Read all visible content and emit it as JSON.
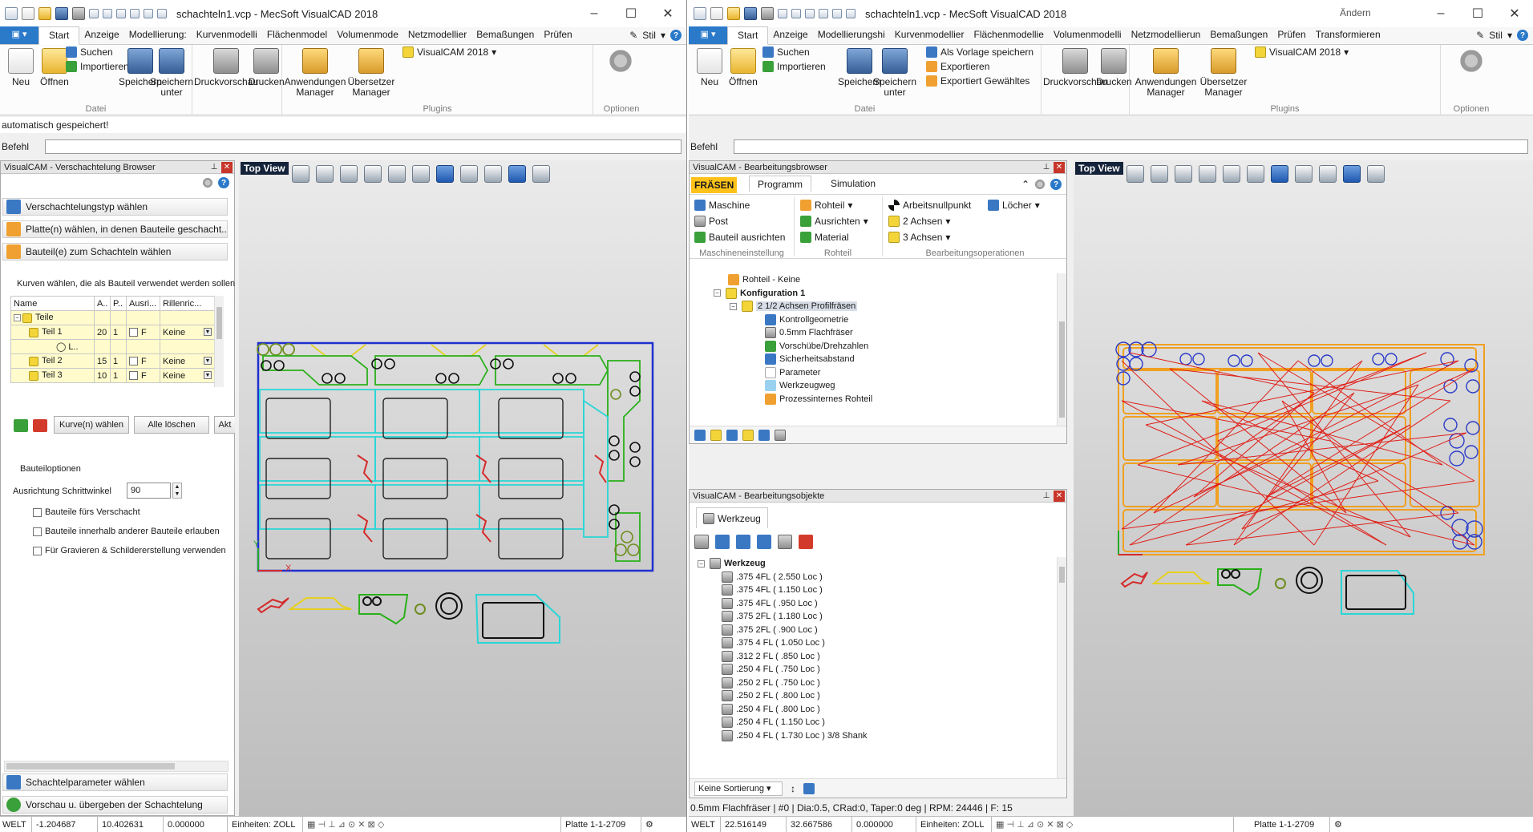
{
  "left": {
    "title": "schachteln1.vcp - MecSoft VisualCAD 2018",
    "tabs": [
      "Start",
      "Anzeige",
      "Modellierung:",
      "Kurvenmodelli",
      "Flächenmodel",
      "Volumenmode",
      "Netzmodellier",
      "Bemaßungen",
      "Prüfen"
    ],
    "style_label": "Stil",
    "ribbon": {
      "new": "Neu",
      "open": "Öffnen",
      "search": "Suchen",
      "import": "Importieren",
      "save": "Speichern",
      "save_as": "Speichern unter",
      "group_file": "Datei",
      "preview": "Druckvorschau",
      "print": "Drucken",
      "app_manager": "Anwendungen Manager",
      "translator": "Übersetzer Manager",
      "visualcam": "VisualCAM 2018",
      "group_plugins": "Plugins",
      "options_group": "Optionen"
    },
    "status_msg": "automatisch gespeichert!",
    "command_label": "Befehl",
    "nest_panel": {
      "title": "VisualCAM - Verschachtelung Browser",
      "step1": "Verschachtelungstyp wählen",
      "step2": "Platte(n) wählen, in denen Bauteile geschacht...",
      "step3": "Bauteil(e) zum Schachteln wählen",
      "hint": "Kurven wählen, die als Bauteil verwendet werden sollen",
      "cols": [
        "Name",
        "A..",
        "P..",
        "Ausri...",
        "Rillenric..."
      ],
      "rows": [
        {
          "name": "Teile",
          "a": "",
          "p": "",
          "aus": "",
          "ril": ""
        },
        {
          "name": "Teil 1",
          "a": "20",
          "p": "1",
          "aus": "F",
          "ril": "Keine"
        },
        {
          "name": "L..",
          "a": "",
          "p": "",
          "aus": "",
          "ril": ""
        },
        {
          "name": "Teil 2",
          "a": "15",
          "p": "1",
          "aus": "F",
          "ril": "Keine"
        },
        {
          "name": "Teil 3",
          "a": "10",
          "p": "1",
          "aus": "F",
          "ril": "Keine"
        }
      ],
      "btn_curves": "Kurve(n) wählen",
      "btn_clear": "Alle löschen",
      "btn_more": "Akt",
      "options_title": "Bauteiloptionen",
      "angle_label": "Ausrichtung Schrittwinkel",
      "angle_value": "90",
      "opt1": "Bauteile fürs Verschacht",
      "opt2": "Bauteile innerhalb anderer Bauteile erlauben",
      "opt3": "Für Gravieren & Schildererstellung verwenden",
      "step4": "Schachtelparameter wählen",
      "step5": "Vorschau u. übergeben der Schachtelung"
    },
    "view_label": "Top View",
    "statusbar": {
      "sys": "WELT",
      "x": "-1.204687",
      "y": "10.402631",
      "z": "0.000000",
      "units": "Einheiten: ZOLL",
      "plate": "Platte 1-1-2709"
    }
  },
  "right": {
    "title": "schachteln1.vcp - MecSoft VisualCAD 2018",
    "tabs": [
      "Start",
      "Anzeige",
      "Modellierungshi",
      "Kurvenmodellier",
      "Flächenmodellie",
      "Volumenmodelli",
      "Netzmodellierun",
      "Bemaßungen",
      "Prüfen",
      "Transformieren"
    ],
    "style_label": "Stil",
    "change_label": "Ändern",
    "ribbon": {
      "new": "Neu",
      "open": "Öffnen",
      "search": "Suchen",
      "import": "Importieren",
      "template": "Als Vorlage speichern",
      "export": "Exportieren",
      "export_sel": "Exportiert Gewähltes",
      "save": "Speichern",
      "save_as": "Speichern unter",
      "group_file": "Datei",
      "preview": "Druckvorschau",
      "print": "Drucken",
      "app_manager": "Anwendungen Manager",
      "translator": "Übersetzer Manager",
      "visualcam": "VisualCAM 2018",
      "group_plugins": "Plugins",
      "options_group": "Optionen"
    },
    "command_label": "Befehl",
    "machining_browser": {
      "title": "VisualCAM - Bearbeitungsbrowser",
      "mode": "FRÄSEN",
      "tab_program": "Programm",
      "tab_sim": "Simulation",
      "machine": "Maschine",
      "post": "Post",
      "align_part": "Bauteil ausrichten",
      "group_machine": "Maschineneinstellung",
      "stock": "Rohteil",
      "align": "Ausrichten",
      "material": "Material",
      "group_stock": "Rohteil",
      "zero": "Arbeitsnullpunkt",
      "holes": "Löcher",
      "axes2": "2 Achsen",
      "axes3": "3 Achsen",
      "group_ops": "Bearbeitungsoperationen",
      "tree": [
        "Rohteil - Keine",
        "Konfiguration 1",
        "2 1/2 Achsen Profilfräsen",
        "Kontrollgeometrie",
        "0.5mm Flachfräser",
        "Vorschübe/Drehzahlen",
        "Sicherheitsabstand",
        "Parameter",
        "Werkzeugweg",
        "Prozessinternes Rohteil"
      ]
    },
    "objects_panel": {
      "title": "VisualCAM - Bearbeitungsobjekte",
      "tab_tool": "Werkzeug",
      "root": "Werkzeug",
      "tools": [
        ".375 4FL ( 2.550 Loc )",
        ".375 4FL ( 1.150 Loc )",
        ".375 4FL ( .950 Loc )",
        ".375 2FL ( 1.180 Loc )",
        ".375 2FL ( .900 Loc )",
        ".375 4 FL ( 1.050 Loc )",
        ".312 2 FL ( .850 Loc )",
        ".250 4 FL ( .750 Loc )",
        ".250 2 FL ( .750 Loc )",
        ".250 2 FL ( .800 Loc )",
        ".250 4 FL ( .800 Loc )",
        ".250 4 FL ( 1.150 Loc )",
        ".250 4 FL ( 1.730 Loc ) 3/8 Shank"
      ],
      "sort": "Keine Sortierung"
    },
    "tool_info": "0.5mm Flachfräser | #0 | Dia:0.5, CRad:0, Taper:0 deg | RPM: 24446 | F: 15",
    "view_label": "Top View",
    "statusbar": {
      "sys": "WELT",
      "x": "22.516149",
      "y": "32.667586",
      "z": "0.000000",
      "units": "Einheiten: ZOLL",
      "plate": "Platte 1-1-2709"
    }
  },
  "colors": {
    "accent": "#2b79c9",
    "view_label_bg": "#15233a",
    "plate_border": "#1f2fd0",
    "toolpath": "#e0201a",
    "contour": "#f0a020"
  }
}
